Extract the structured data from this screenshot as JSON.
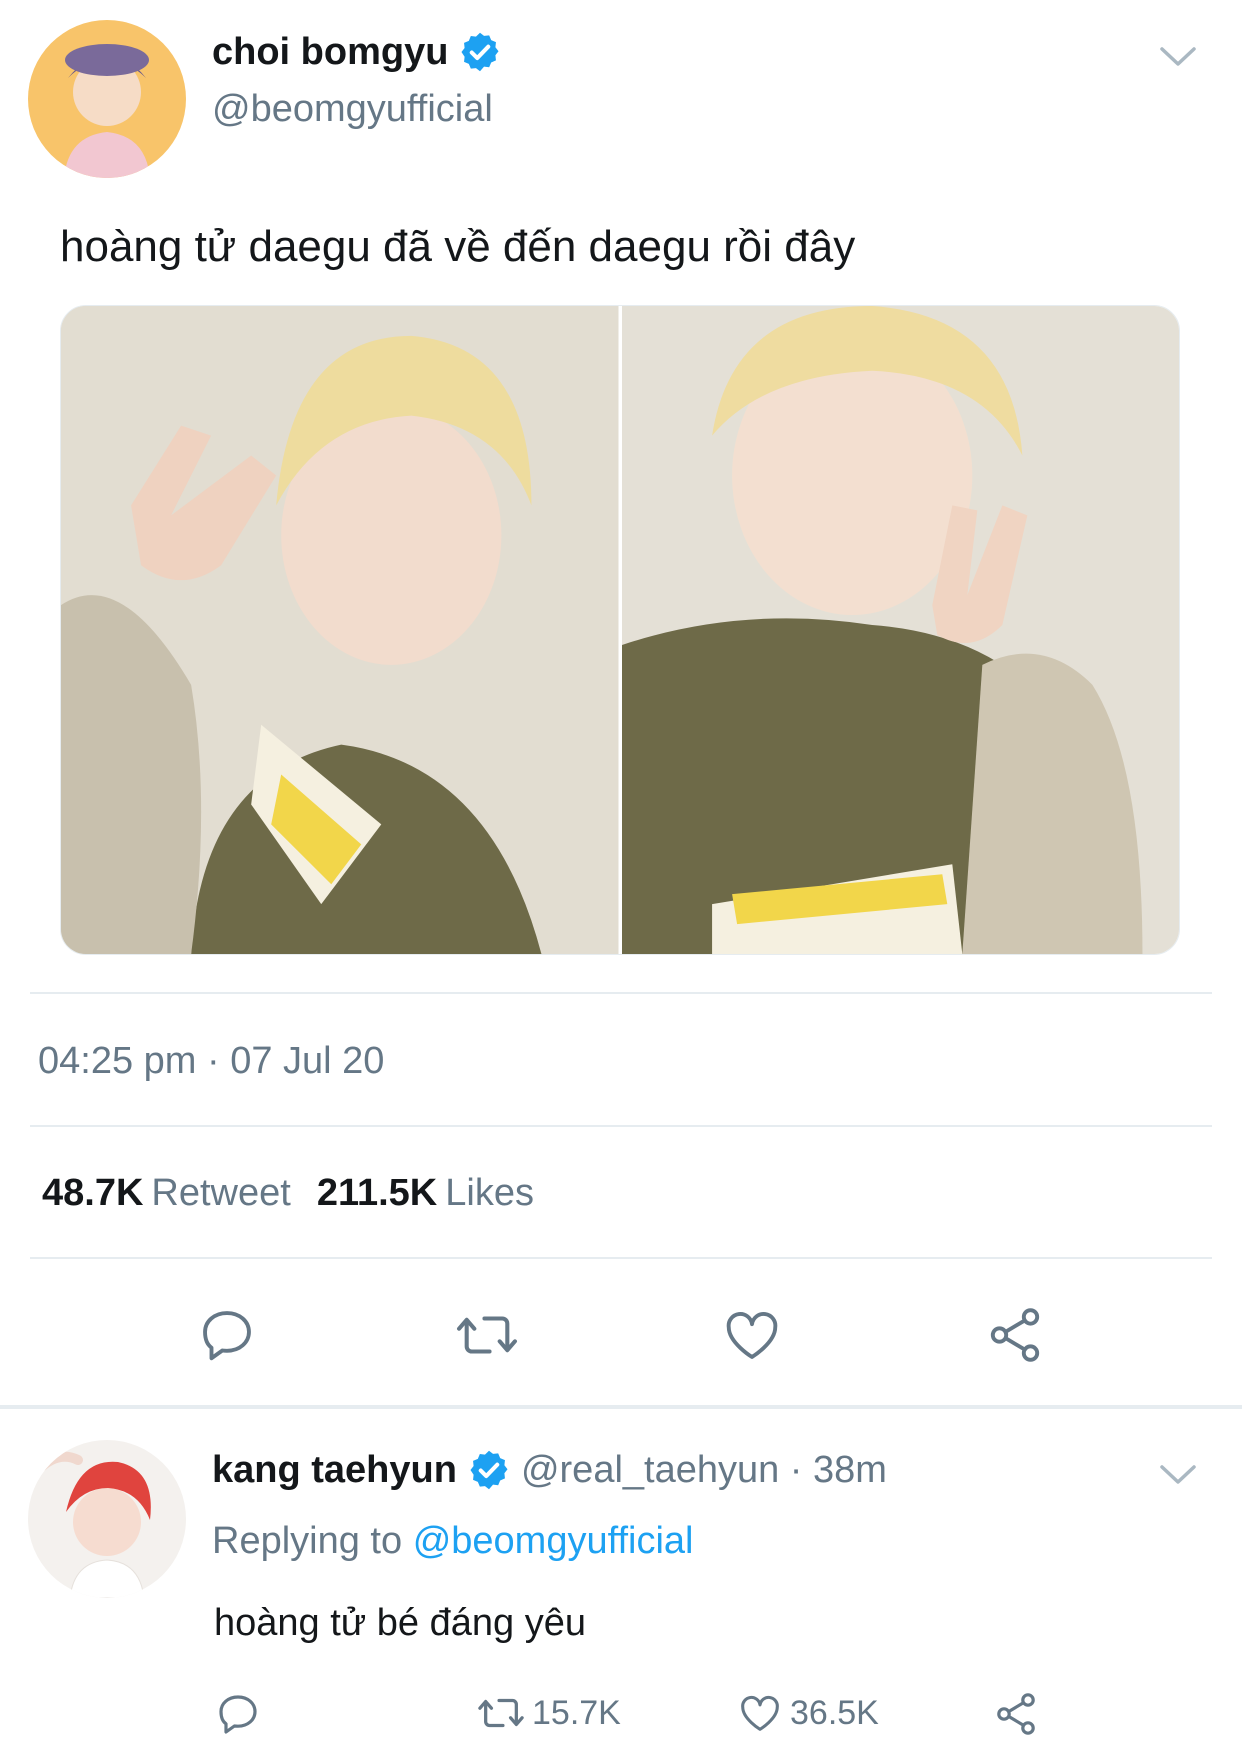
{
  "tweet": {
    "display_name": "choi bomgyu",
    "handle": "@beomgyufficial",
    "text": "hoàng tử daegu đã về đến daegu rồi đây",
    "media_count": 2,
    "timestamp": "04:25 pm · 07 Jul 20",
    "retweets_count": "48.7K",
    "retweets_label": "Retweet",
    "likes_count": "211.5K",
    "likes_label": "Likes",
    "icons": [
      "chevron-down-icon",
      "verified-badge-icon",
      "reply-icon",
      "retweet-icon",
      "like-icon",
      "share-icon"
    ]
  },
  "reply": {
    "display_name": "kang taehyun",
    "handle_time": "@real_taehyun · 38m",
    "replying_prefix": "Replying to",
    "replying_to": "@beomgyufficial",
    "text": "hoàng tử bé đáng yêu",
    "retweets": "15.7K",
    "likes": "36.5K"
  },
  "colors": {
    "accent": "#1da1f2",
    "muted_text": "#657786",
    "divider": "#e6ecf0"
  }
}
